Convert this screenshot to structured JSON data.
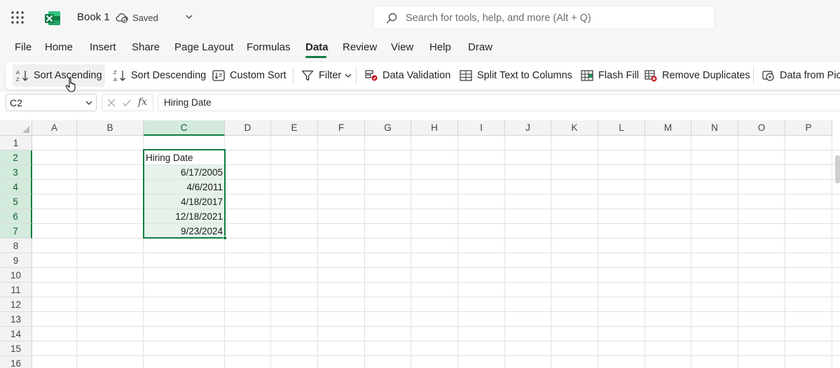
{
  "titlebar": {
    "book_title": "Book 1",
    "save_status": "Saved",
    "search_placeholder": "Search for tools, help, and more (Alt + Q)"
  },
  "menu": {
    "tabs": [
      "File",
      "Home",
      "Insert",
      "Share",
      "Page Layout",
      "Formulas",
      "Data",
      "Review",
      "View",
      "Help",
      "Draw"
    ],
    "active_tab": "Data"
  },
  "ribbon": {
    "sort_ascending": "Sort Ascending",
    "sort_descending": "Sort Descending",
    "custom_sort": "Custom Sort",
    "filter": "Filter",
    "data_validation": "Data Validation",
    "split_text": "Split Text to Columns",
    "flash_fill": "Flash Fill",
    "remove_duplicates": "Remove Duplicates",
    "data_from_picture": "Data from Picture"
  },
  "formula_bar": {
    "name_box": "C2",
    "fx_label": "fx",
    "formula": "Hiring Date"
  },
  "grid": {
    "columns": [
      "A",
      "B",
      "C",
      "D",
      "E",
      "F",
      "G",
      "H",
      "I",
      "J",
      "K",
      "L",
      "M",
      "N",
      "O",
      "P"
    ],
    "rows": [
      "1",
      "2",
      "3",
      "4",
      "5",
      "6",
      "7",
      "8",
      "9",
      "10",
      "11",
      "12",
      "13",
      "14",
      "15",
      "16"
    ],
    "selected_column": "C",
    "selected_rows": [
      "2",
      "3",
      "4",
      "5",
      "6",
      "7"
    ],
    "cells": {
      "C2": "Hiring Date",
      "C3": "6/17/2005",
      "C4": "4/6/2011",
      "C5": "4/18/2017",
      "C6": "12/18/2021",
      "C7": "9/23/2024"
    }
  },
  "colors": {
    "accent": "#107c41",
    "selection_fill": "#e6f2ea",
    "header_selected": "#d3ebdc"
  },
  "icons": [
    "app-launcher-icon",
    "excel-logo-icon",
    "cloud-saved-icon",
    "chevron-down-icon",
    "search-icon",
    "sort-ascending-icon",
    "sort-descending-icon",
    "custom-sort-icon",
    "filter-icon",
    "data-validation-icon",
    "split-text-icon",
    "flash-fill-icon",
    "remove-duplicates-icon",
    "data-from-picture-icon",
    "hand-cursor-icon"
  ]
}
